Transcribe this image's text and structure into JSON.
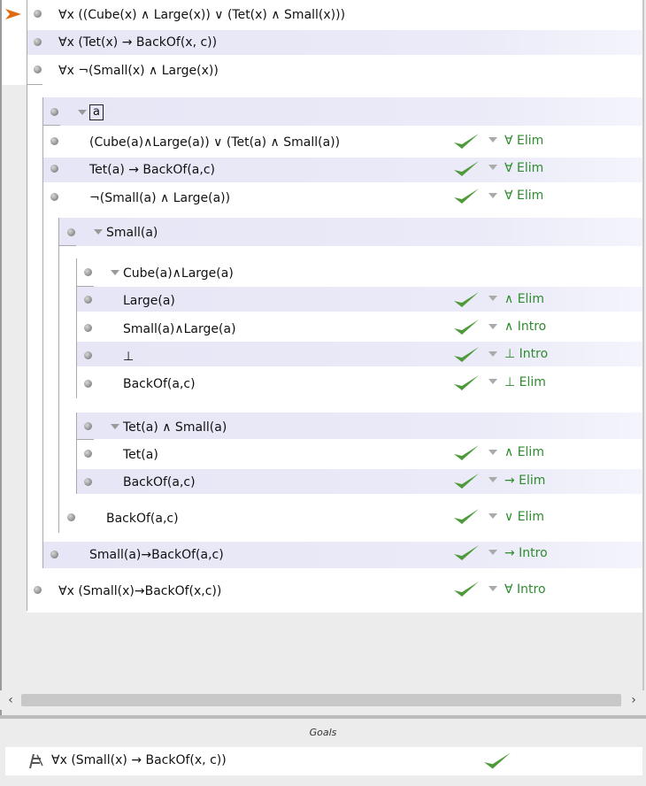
{
  "proof": {
    "premises": [
      {
        "formula": "∀x ((Cube(x) ∧ Large(x)) ∨ (Tet(x) ∧ Small(x)))"
      },
      {
        "formula": "∀x (Tet(x) → BackOf(x, c))"
      },
      {
        "formula": "∀x ¬(Small(x) ∧ Large(x))"
      }
    ],
    "subproof_a": {
      "assumption": "a",
      "steps": [
        {
          "formula": "(Cube(a)∧Large(a)) ∨ (Tet(a) ∧ Small(a))",
          "rule": "∀ Elim"
        },
        {
          "formula": "Tet(a) → BackOf(a,c)",
          "rule": "∀ Elim"
        },
        {
          "formula": "¬(Small(a) ∧ Large(a))",
          "rule": "∀ Elim"
        }
      ],
      "subproof_small": {
        "assumption": "Small(a)",
        "case1": {
          "assumption": "Cube(a)∧Large(a)",
          "steps": [
            {
              "formula": "Large(a)",
              "rule": "∧ Elim"
            },
            {
              "formula": "Small(a)∧Large(a)",
              "rule": "∧ Intro"
            },
            {
              "formula": "⊥",
              "rule": "⊥ Intro"
            },
            {
              "formula": "BackOf(a,c)",
              "rule": "⊥ Elim"
            }
          ]
        },
        "case2": {
          "assumption": "Tet(a) ∧ Small(a)",
          "steps": [
            {
              "formula": "Tet(a)",
              "rule": "∧ Elim"
            },
            {
              "formula": "BackOf(a,c)",
              "rule": "→ Elim"
            }
          ]
        },
        "conclusion": {
          "formula": "BackOf(a,c)",
          "rule": "∨ Elim"
        }
      },
      "conclusion": {
        "formula": "Small(a)→BackOf(a,c)",
        "rule": "→ Intro"
      }
    },
    "conclusion": {
      "formula": "∀x (Small(x)→BackOf(x,c))",
      "rule": "∀ Intro"
    }
  },
  "goals": {
    "title": "Goals",
    "items": [
      {
        "formula": "∀x (Small(x) → BackOf(x, c))"
      }
    ]
  },
  "colors": {
    "check": "#4e9a3a",
    "rule": "#2e8b2e",
    "pointer": "#e06a10",
    "band": "#e8e8f8"
  },
  "icons": {
    "pointer": "arrow-pointer-icon",
    "check": "checkmark-icon",
    "goal": "goal-turnstile-icon",
    "scroll_left": "chevron-left-icon",
    "scroll_right": "chevron-right-icon"
  }
}
